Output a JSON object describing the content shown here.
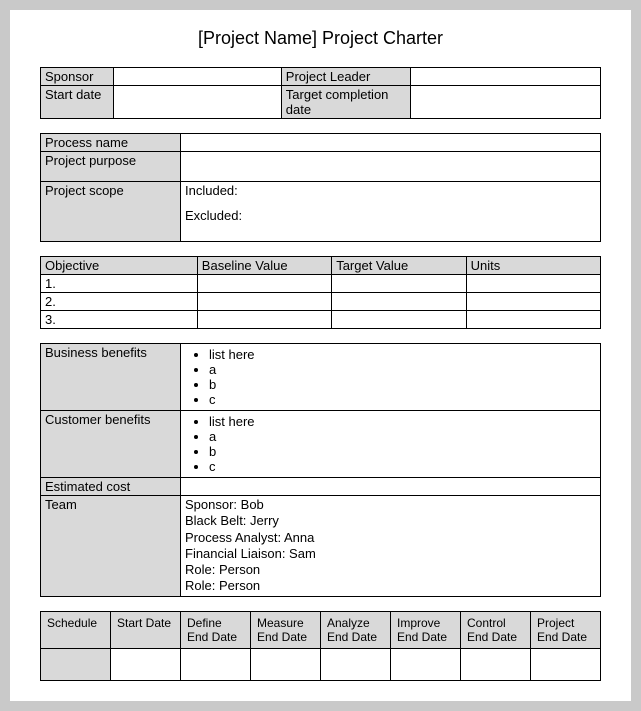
{
  "title": "[Project Name] Project Charter",
  "hdr": {
    "sponsor_lbl": "Sponsor",
    "sponsor_val": "",
    "leader_lbl": "Project Leader",
    "leader_val": "",
    "start_lbl": "Start date",
    "start_val": "",
    "target_lbl": "Target completion date",
    "target_val": ""
  },
  "proc": {
    "name_lbl": "Process name",
    "name_val": "",
    "purpose_lbl": "Project purpose",
    "purpose_val": "",
    "scope_lbl": "Project scope",
    "included_lbl": "Included:",
    "excluded_lbl": "Excluded:"
  },
  "obj": {
    "h_obj": "Objective",
    "h_base": "Baseline Value",
    "h_target": "Target Value",
    "h_units": "Units",
    "rows": [
      {
        "n": "1.",
        "b": "",
        "t": "",
        "u": ""
      },
      {
        "n": "2.",
        "b": "",
        "t": "",
        "u": ""
      },
      {
        "n": "3.",
        "b": "",
        "t": "",
        "u": ""
      }
    ]
  },
  "ben": {
    "biz_lbl": "Business benefits",
    "cust_lbl": "Customer benefits",
    "biz_items": [
      "list here",
      "a",
      "b",
      "c"
    ],
    "cust_items": [
      "list here",
      "a",
      "b",
      "c"
    ]
  },
  "cost": {
    "lbl": "Estimated cost",
    "val": ""
  },
  "team": {
    "lbl": "Team",
    "lines": [
      "Sponsor: Bob",
      "Black Belt: Jerry",
      "Process Analyst: Anna",
      "Financial Liaison: Sam",
      "Role: Person",
      "Role: Person"
    ]
  },
  "sched": {
    "h": [
      "Schedule",
      "Start Date",
      "Define End Date",
      "Measure End Date",
      "Analyze End Date",
      "Improve End Date",
      "Control End Date",
      "Project End Date"
    ],
    "r": [
      "",
      "",
      "",
      "",
      "",
      "",
      "",
      ""
    ]
  }
}
